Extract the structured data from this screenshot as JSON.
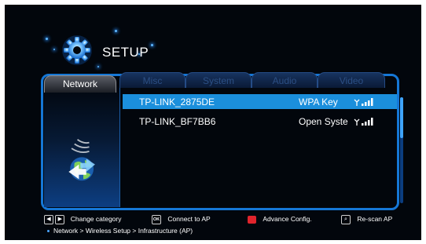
{
  "header": {
    "title": "SETUP"
  },
  "tabs": [
    {
      "label": "Network",
      "active": true
    },
    {
      "label": "Misc",
      "active": false
    },
    {
      "label": "System",
      "active": false
    },
    {
      "label": "Audio",
      "active": false
    },
    {
      "label": "Video",
      "active": false
    }
  ],
  "networks": [
    {
      "ssid": "TP-LINK_2875DE",
      "security": "WPA Key",
      "selected": true
    },
    {
      "ssid": "TP-LINK_BF7BB6",
      "security": "Open Syste",
      "selected": false
    }
  ],
  "footer": {
    "change_category": "Change category",
    "ok_key": "OK",
    "connect": "Connect to AP",
    "advance": "Advance Config.",
    "rescan": "Re-scan AP",
    "breadcrumb": "Network > Wireless Setup > Infrastructure (AP)"
  },
  "colors": {
    "accent": "#1577d6",
    "selection": "#1b8fdc",
    "background": "#02060c"
  }
}
